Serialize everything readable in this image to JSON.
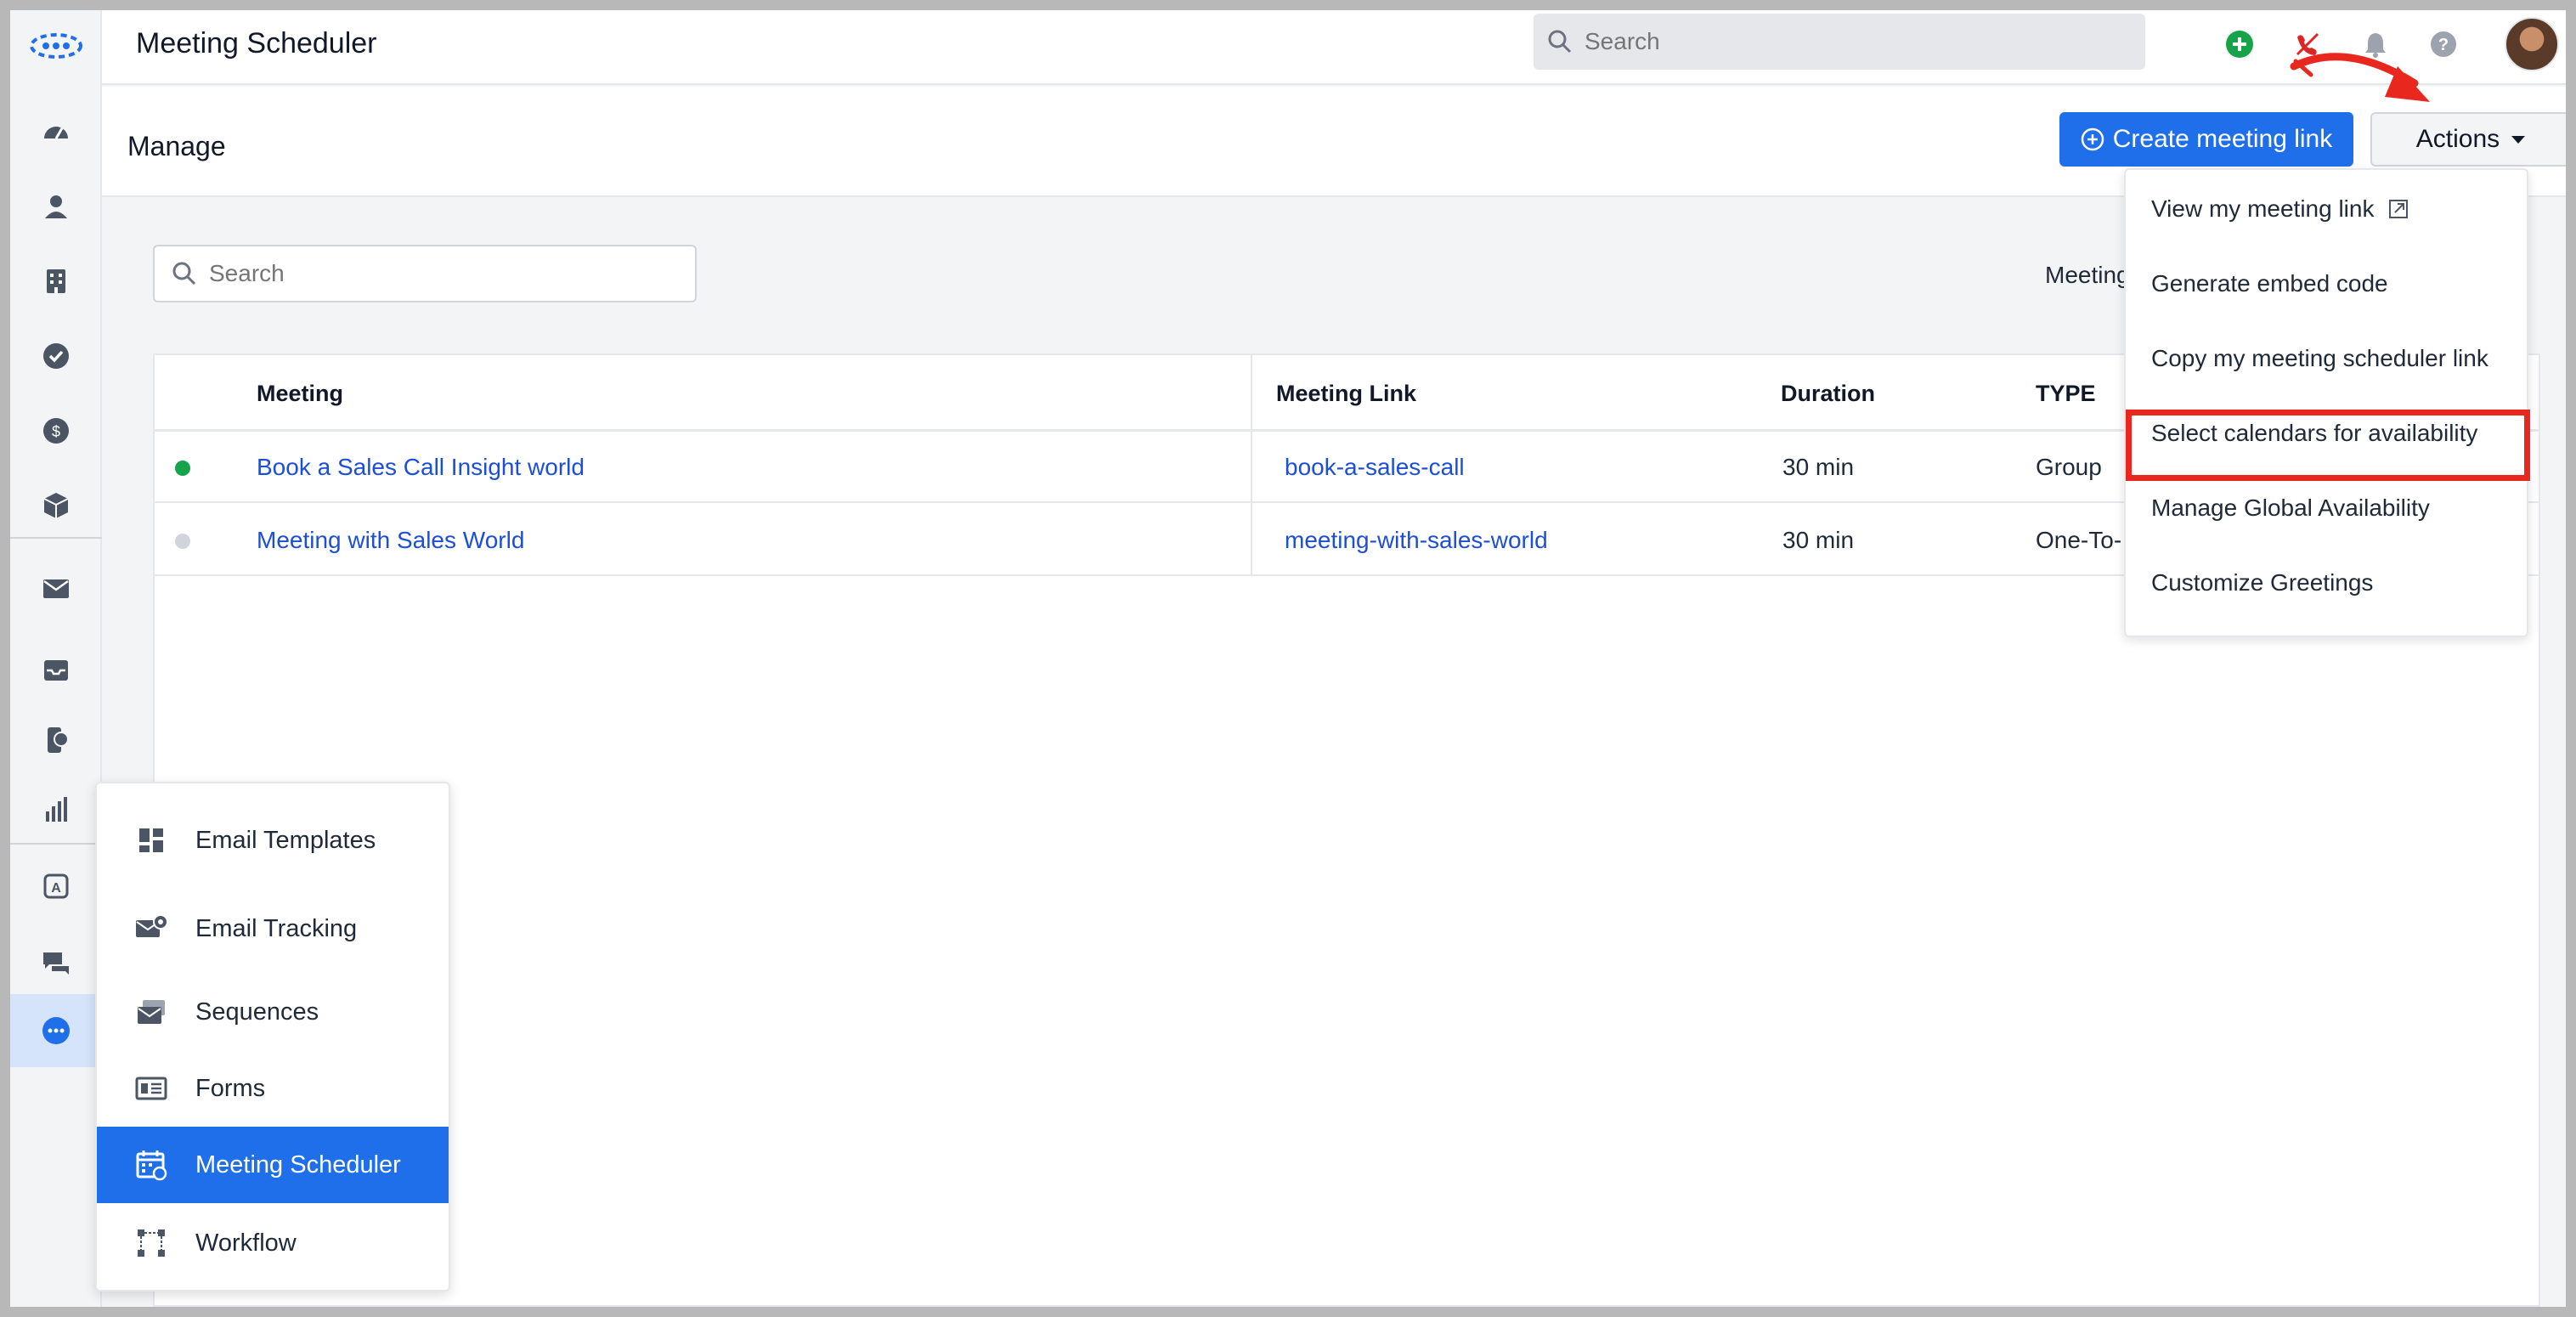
{
  "header": {
    "title": "Meeting Scheduler",
    "search_placeholder": "Search"
  },
  "manage": {
    "title": "Manage",
    "create_button": "Create meeting link",
    "actions_button": "Actions"
  },
  "content": {
    "search_placeholder": "Search",
    "filter_label": "Meeting"
  },
  "table": {
    "columns": [
      "Meeting",
      "Meeting Link",
      "Duration",
      "TYPE"
    ],
    "rows": [
      {
        "meeting": "Book a Sales Call Insight world",
        "link": "book-a-sales-call",
        "duration": "30 min",
        "type": "Group",
        "status_color": "#16a34a"
      },
      {
        "meeting": "Meeting with Sales World",
        "link": "meeting-with-sales-world",
        "duration": "30 min",
        "type": "One-To-",
        "status_color": "#d1d5db"
      }
    ]
  },
  "actions_menu": {
    "items": [
      "View my meeting link",
      "Generate embed code",
      "Copy my meeting scheduler link",
      "Select calendars for availability",
      "Manage Global Availability",
      "Customize Greetings"
    ],
    "highlighted_index": 3
  },
  "more_menu": {
    "items": [
      {
        "label": "Email Templates",
        "icon": "email-templates-icon"
      },
      {
        "label": "Email Tracking",
        "icon": "email-tracking-icon"
      },
      {
        "label": "Sequences",
        "icon": "sequences-icon"
      },
      {
        "label": "Forms",
        "icon": "forms-icon"
      },
      {
        "label": "Meeting Scheduler",
        "icon": "meeting-scheduler-icon"
      },
      {
        "label": "Workflow",
        "icon": "workflow-icon"
      }
    ],
    "active_index": 4
  },
  "colors": {
    "primary": "#1f6feb",
    "highlight_border": "#e8281e",
    "active_status": "#16a34a",
    "inactive_status": "#d1d5db"
  }
}
